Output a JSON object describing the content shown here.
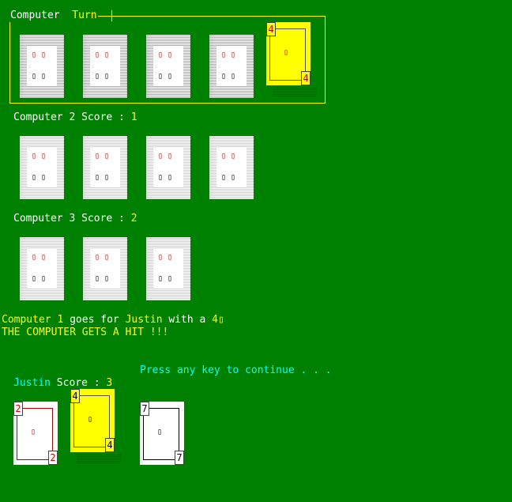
{
  "computer1": {
    "label": "Computer",
    "turn_label": "Turn"
  },
  "computer2": {
    "label": "Computer 2 Score : ",
    "score": "1"
  },
  "computer3": {
    "label": "Computer 3 Score : ",
    "score": "2"
  },
  "card_glyph": "▯",
  "played_card": {
    "rank": "4",
    "color": "red"
  },
  "message": {
    "player": "Computer 1",
    "goes_for": " goes for ",
    "target": "Justin",
    "with_a": " with a ",
    "card": "4▯",
    "hit": "THE COMPUTER GETS A HIT !!!"
  },
  "prompt": "Press any key to continue . . .",
  "player": {
    "name": "Justin",
    "score_label": " Score : ",
    "score": "3",
    "cards": [
      {
        "rank": "2",
        "color": "red",
        "selected": false
      },
      {
        "rank": "4",
        "color": "black",
        "selected": true
      },
      {
        "rank": "7",
        "color": "black",
        "selected": false
      }
    ]
  },
  "colors": {
    "background": "#008000",
    "highlight": "#ffff00",
    "prompt": "#00ffff"
  }
}
